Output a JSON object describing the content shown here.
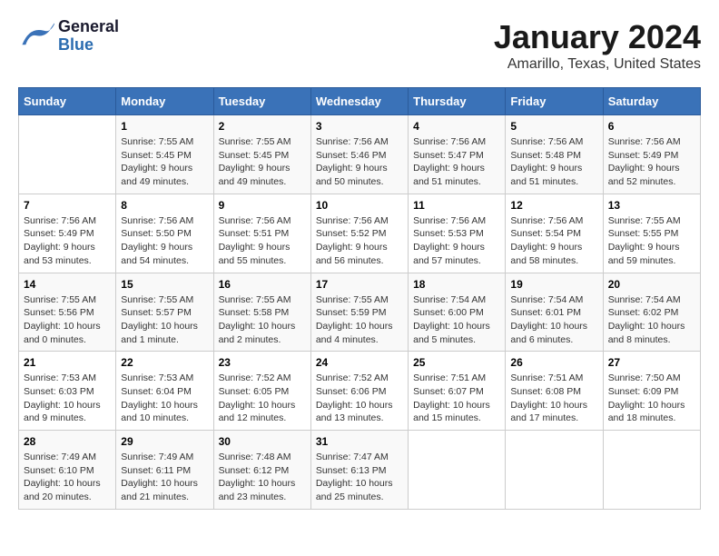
{
  "header": {
    "logo_general": "General",
    "logo_blue": "Blue",
    "title": "January 2024",
    "subtitle": "Amarillo, Texas, United States"
  },
  "calendar": {
    "days_of_week": [
      "Sunday",
      "Monday",
      "Tuesday",
      "Wednesday",
      "Thursday",
      "Friday",
      "Saturday"
    ],
    "weeks": [
      [
        {
          "day": "",
          "info": ""
        },
        {
          "day": "1",
          "info": "Sunrise: 7:55 AM\nSunset: 5:45 PM\nDaylight: 9 hours\nand 49 minutes."
        },
        {
          "day": "2",
          "info": "Sunrise: 7:55 AM\nSunset: 5:45 PM\nDaylight: 9 hours\nand 49 minutes."
        },
        {
          "day": "3",
          "info": "Sunrise: 7:56 AM\nSunset: 5:46 PM\nDaylight: 9 hours\nand 50 minutes."
        },
        {
          "day": "4",
          "info": "Sunrise: 7:56 AM\nSunset: 5:47 PM\nDaylight: 9 hours\nand 51 minutes."
        },
        {
          "day": "5",
          "info": "Sunrise: 7:56 AM\nSunset: 5:48 PM\nDaylight: 9 hours\nand 51 minutes."
        },
        {
          "day": "6",
          "info": "Sunrise: 7:56 AM\nSunset: 5:49 PM\nDaylight: 9 hours\nand 52 minutes."
        }
      ],
      [
        {
          "day": "7",
          "info": "Sunrise: 7:56 AM\nSunset: 5:49 PM\nDaylight: 9 hours\nand 53 minutes."
        },
        {
          "day": "8",
          "info": "Sunrise: 7:56 AM\nSunset: 5:50 PM\nDaylight: 9 hours\nand 54 minutes."
        },
        {
          "day": "9",
          "info": "Sunrise: 7:56 AM\nSunset: 5:51 PM\nDaylight: 9 hours\nand 55 minutes."
        },
        {
          "day": "10",
          "info": "Sunrise: 7:56 AM\nSunset: 5:52 PM\nDaylight: 9 hours\nand 56 minutes."
        },
        {
          "day": "11",
          "info": "Sunrise: 7:56 AM\nSunset: 5:53 PM\nDaylight: 9 hours\nand 57 minutes."
        },
        {
          "day": "12",
          "info": "Sunrise: 7:56 AM\nSunset: 5:54 PM\nDaylight: 9 hours\nand 58 minutes."
        },
        {
          "day": "13",
          "info": "Sunrise: 7:55 AM\nSunset: 5:55 PM\nDaylight: 9 hours\nand 59 minutes."
        }
      ],
      [
        {
          "day": "14",
          "info": "Sunrise: 7:55 AM\nSunset: 5:56 PM\nDaylight: 10 hours\nand 0 minutes."
        },
        {
          "day": "15",
          "info": "Sunrise: 7:55 AM\nSunset: 5:57 PM\nDaylight: 10 hours\nand 1 minute."
        },
        {
          "day": "16",
          "info": "Sunrise: 7:55 AM\nSunset: 5:58 PM\nDaylight: 10 hours\nand 2 minutes."
        },
        {
          "day": "17",
          "info": "Sunrise: 7:55 AM\nSunset: 5:59 PM\nDaylight: 10 hours\nand 4 minutes."
        },
        {
          "day": "18",
          "info": "Sunrise: 7:54 AM\nSunset: 6:00 PM\nDaylight: 10 hours\nand 5 minutes."
        },
        {
          "day": "19",
          "info": "Sunrise: 7:54 AM\nSunset: 6:01 PM\nDaylight: 10 hours\nand 6 minutes."
        },
        {
          "day": "20",
          "info": "Sunrise: 7:54 AM\nSunset: 6:02 PM\nDaylight: 10 hours\nand 8 minutes."
        }
      ],
      [
        {
          "day": "21",
          "info": "Sunrise: 7:53 AM\nSunset: 6:03 PM\nDaylight: 10 hours\nand 9 minutes."
        },
        {
          "day": "22",
          "info": "Sunrise: 7:53 AM\nSunset: 6:04 PM\nDaylight: 10 hours\nand 10 minutes."
        },
        {
          "day": "23",
          "info": "Sunrise: 7:52 AM\nSunset: 6:05 PM\nDaylight: 10 hours\nand 12 minutes."
        },
        {
          "day": "24",
          "info": "Sunrise: 7:52 AM\nSunset: 6:06 PM\nDaylight: 10 hours\nand 13 minutes."
        },
        {
          "day": "25",
          "info": "Sunrise: 7:51 AM\nSunset: 6:07 PM\nDaylight: 10 hours\nand 15 minutes."
        },
        {
          "day": "26",
          "info": "Sunrise: 7:51 AM\nSunset: 6:08 PM\nDaylight: 10 hours\nand 17 minutes."
        },
        {
          "day": "27",
          "info": "Sunrise: 7:50 AM\nSunset: 6:09 PM\nDaylight: 10 hours\nand 18 minutes."
        }
      ],
      [
        {
          "day": "28",
          "info": "Sunrise: 7:49 AM\nSunset: 6:10 PM\nDaylight: 10 hours\nand 20 minutes."
        },
        {
          "day": "29",
          "info": "Sunrise: 7:49 AM\nSunset: 6:11 PM\nDaylight: 10 hours\nand 21 minutes."
        },
        {
          "day": "30",
          "info": "Sunrise: 7:48 AM\nSunset: 6:12 PM\nDaylight: 10 hours\nand 23 minutes."
        },
        {
          "day": "31",
          "info": "Sunrise: 7:47 AM\nSunset: 6:13 PM\nDaylight: 10 hours\nand 25 minutes."
        },
        {
          "day": "",
          "info": ""
        },
        {
          "day": "",
          "info": ""
        },
        {
          "day": "",
          "info": ""
        }
      ]
    ]
  }
}
